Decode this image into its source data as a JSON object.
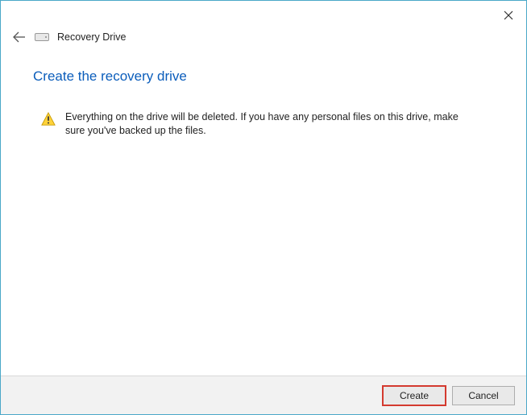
{
  "window": {
    "title": "Recovery Drive"
  },
  "page": {
    "heading": "Create the recovery drive",
    "warning_text": "Everything on the drive will be deleted. If you have any personal files on this drive, make sure you've backed up the files."
  },
  "footer": {
    "create_label": "Create",
    "cancel_label": "Cancel"
  }
}
